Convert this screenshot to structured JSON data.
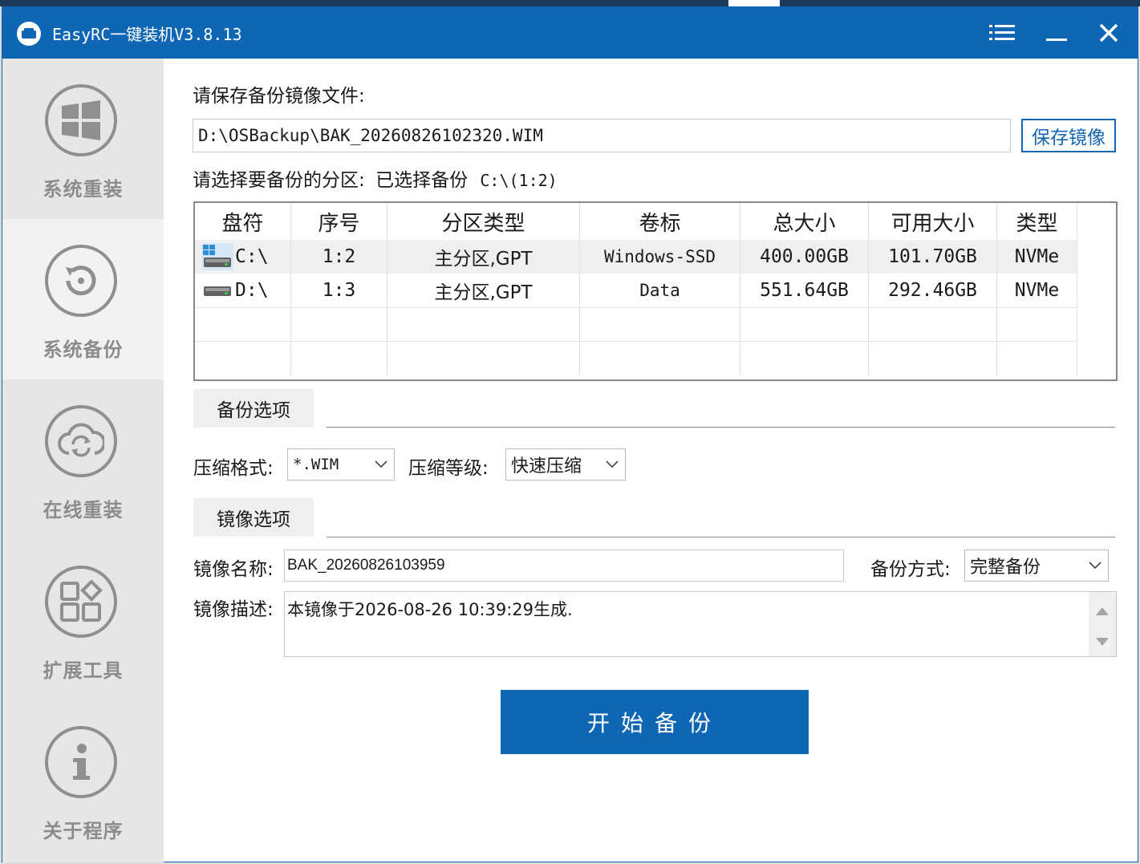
{
  "window": {
    "title": "EasyRC一键装机V3.8.13"
  },
  "sidebar": {
    "items": [
      {
        "label": "系统重装",
        "icon": "windows-icon"
      },
      {
        "label": "系统备份",
        "icon": "backup-restore-icon"
      },
      {
        "label": "在线重装",
        "icon": "cloud-sync-icon"
      },
      {
        "label": "扩展工具",
        "icon": "apps-grid-icon"
      },
      {
        "label": "关于程序",
        "icon": "info-icon"
      }
    ]
  },
  "backup": {
    "save_label": "请保存备份镜像文件:",
    "save_path": "D:\\OSBackup\\BAK_20260826102320.WIM",
    "save_button": "保存镜像",
    "partition_label": "请选择要备份的分区:",
    "selected_prefix": "已选择备份",
    "selected_value": "C:\\(1:2)"
  },
  "table": {
    "columns": [
      "盘符",
      "序号",
      "分区类型",
      "卷标",
      "总大小",
      "可用大小",
      "类型"
    ],
    "rows": [
      {
        "drive": "C:\\",
        "index": "1:2",
        "part_type": "主分区,GPT",
        "volume": "Windows-SSD",
        "total": "400.00GB",
        "free": "101.70GB",
        "bus": "NVMe"
      },
      {
        "drive": "D:\\",
        "index": "1:3",
        "part_type": "主分区,GPT",
        "volume": "Data",
        "total": "551.64GB",
        "free": "292.46GB",
        "bus": "NVMe"
      }
    ]
  },
  "backup_options": {
    "section_title": "备份选项",
    "compress_format_label": "压缩格式:",
    "compress_format_value": "*.WIM",
    "compress_level_label": "压缩等级:",
    "compress_level_value": "快速压缩"
  },
  "image_options": {
    "section_title": "镜像选项",
    "name_label": "镜像名称:",
    "name_value": "BAK_20260826103959",
    "mode_label": "备份方式:",
    "mode_value": "完整备份",
    "desc_label": "镜像描述:",
    "desc_value": "本镜像于2026-08-26 10:39:29生成."
  },
  "actions": {
    "start_button": "开始备份"
  },
  "colors": {
    "accent": "#0e66b4",
    "sidebar_bg": "#e6e6e6",
    "sidebar_text": "#8c8c8c"
  }
}
